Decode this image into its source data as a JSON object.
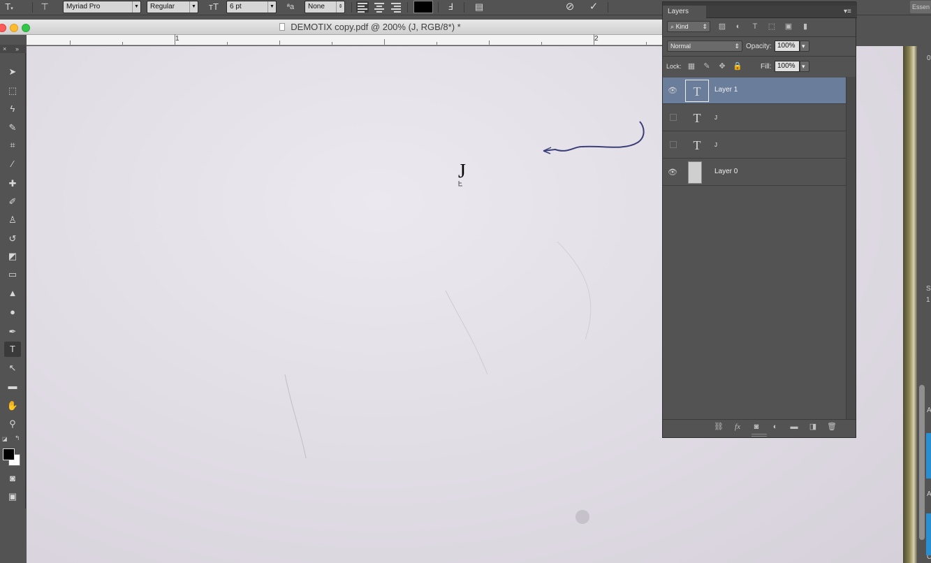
{
  "options_bar": {
    "font_family": "Myriad Pro",
    "font_style": "Regular",
    "font_size": "6 pt",
    "anti_alias": "None",
    "text_color": "#000000",
    "essentials": "Essen"
  },
  "document": {
    "title": "DEMOTIX copy.pdf @ 200% (J, RGB/8*) *",
    "ruler_labels": [
      "1",
      "2"
    ],
    "text_layer_content": "J"
  },
  "layers_panel": {
    "tab": "Layers",
    "filter_kind": "Kind",
    "blend_mode": "Normal",
    "opacity_label": "Opacity:",
    "opacity_value": "100%",
    "lock_label": "Lock:",
    "fill_label": "Fill:",
    "fill_value": "100%",
    "layers": [
      {
        "name": "Layer 1",
        "visible": true,
        "type": "text",
        "selected": true
      },
      {
        "name": "J",
        "visible": false,
        "type": "text",
        "selected": false
      },
      {
        "name": "J",
        "visible": false,
        "type": "text",
        "selected": false
      },
      {
        "name": "Layer 0",
        "visible": true,
        "type": "image",
        "selected": false
      }
    ]
  },
  "right_edge": {
    "labels": [
      "0",
      "S",
      "1",
      "A",
      "A",
      "C"
    ]
  },
  "colors": {
    "selection": "#6a7d9b",
    "accent": "#2a8fd0"
  }
}
